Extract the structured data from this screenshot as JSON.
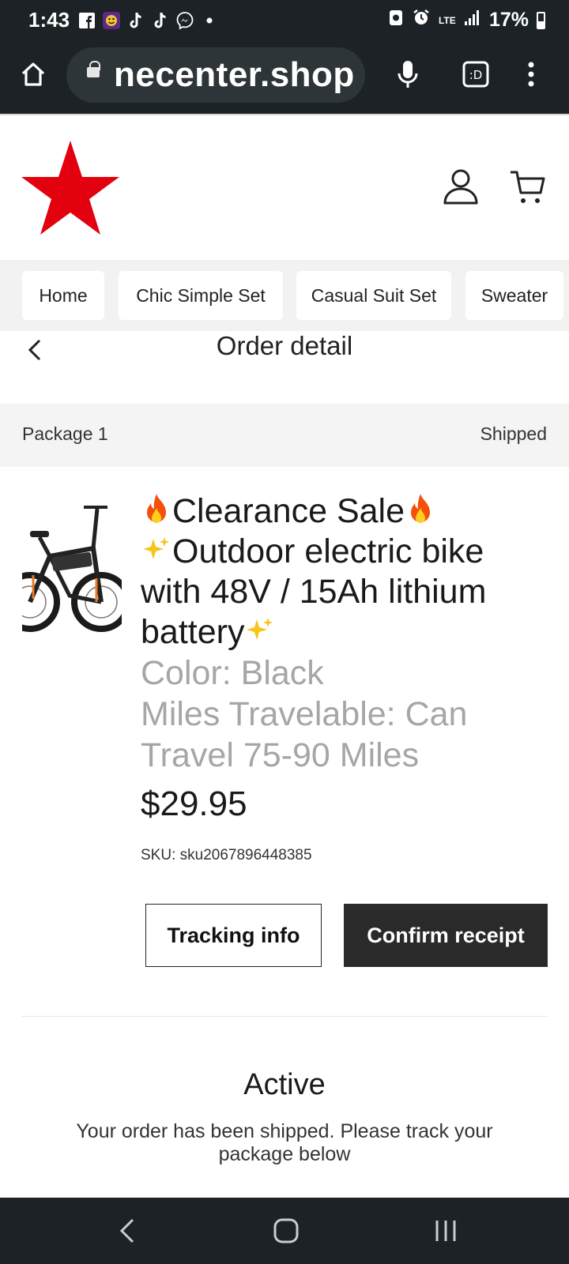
{
  "status_bar": {
    "time": "1:43",
    "battery": "17%",
    "network": "LTE",
    "app_icons": [
      "facebook-icon",
      "game-icon",
      "tiktok-icon",
      "tiktok-icon",
      "messenger-icon",
      "dot-icon"
    ]
  },
  "browser": {
    "url": "necenter.shop"
  },
  "nav": {
    "items": [
      {
        "label": "Home"
      },
      {
        "label": "Chic Simple Set"
      },
      {
        "label": "Casual Suit Set"
      },
      {
        "label": "Sweater"
      }
    ]
  },
  "page": {
    "title": "Order detail"
  },
  "package": {
    "label": "Package 1",
    "status": "Shipped"
  },
  "product": {
    "title_part1": "Clearance Sale",
    "title_part2": "Outdoor electric bike with 48V / 15Ah lithium battery",
    "color": "Color: Black",
    "miles": "Miles Travelable: Can Travel 75-90 Miles",
    "price": "$29.95",
    "sku": "SKU: sku2067896448385"
  },
  "actions": {
    "tracking": "Tracking info",
    "confirm": "Confirm receipt"
  },
  "order_status": {
    "title": "Active",
    "description": "Your order has been shipped. Please track your package below"
  },
  "colors": {
    "accent_red": "#e3000f",
    "dark": "#2a2a2a",
    "muted_text": "#a6a6a6"
  }
}
